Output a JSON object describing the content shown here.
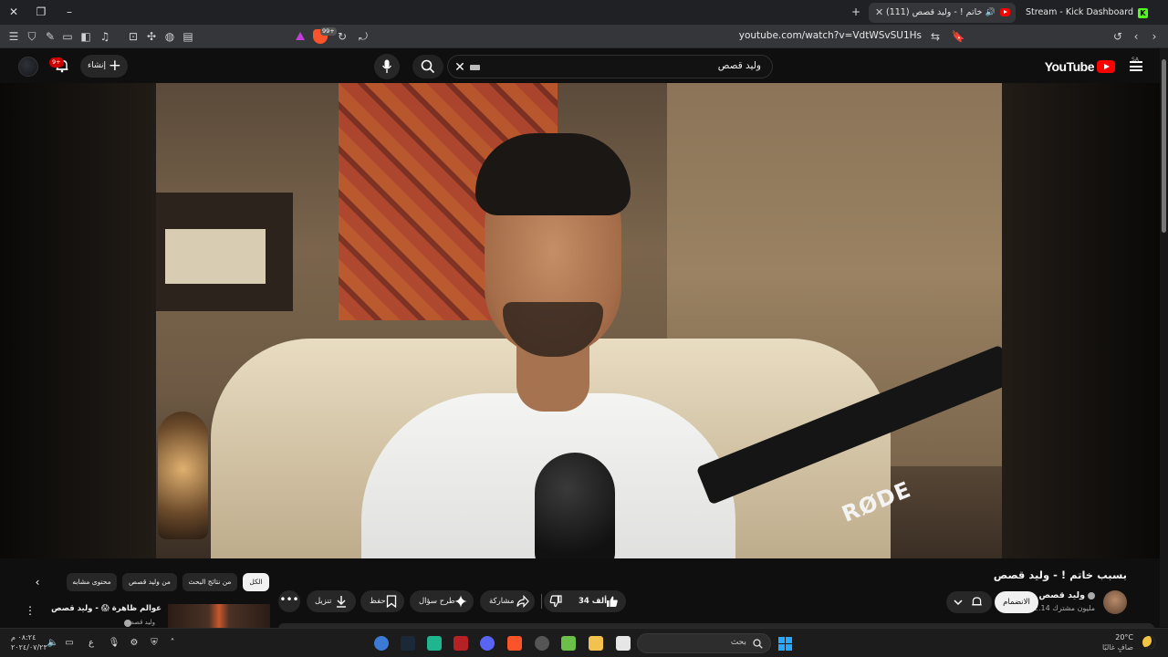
{
  "browser": {
    "tabs": [
      {
        "title": "(111) بسبب خاتم ! - وليد قصص",
        "active": true,
        "favicon": "youtube-icon"
      },
      {
        "title": "Stream - Kick Dashboard",
        "active": false,
        "favicon": "kick-icon"
      }
    ],
    "url": "youtube.com/watch?v=VdtWSvSU1Hs",
    "shields_badge": "99+"
  },
  "youtube": {
    "logo_text": "YouTube",
    "country_code": "SA",
    "search_query": "وليد قصص",
    "create_label": "إنشاء",
    "notifications_badge": "9+"
  },
  "video": {
    "title": "بسبب خاتم ! - وليد قصص",
    "channel": "وليد قصص",
    "subscribers": "2.14 مليون مشترك",
    "join_label": "الانضمام",
    "likes": "34 ألف",
    "share_label": "مشاركة",
    "ask_label": "طرح سؤال",
    "save_label": "حفظ",
    "download_label": "تنزيل",
    "overlay_brand": "RØDE"
  },
  "chips": [
    {
      "label": "الكل",
      "active": true
    },
    {
      "label": "من نتائج البحث",
      "active": false
    },
    {
      "label": "من وليد قصص",
      "active": false
    },
    {
      "label": "محتوى مشابه",
      "active": false
    }
  ],
  "recommended": {
    "title": "عوالم ظاهرة 😱 - وليد قصص",
    "channel": "وليد قصص"
  },
  "taskbar": {
    "search_placeholder": "بحث",
    "weather_temp": "20°C",
    "weather_desc": "صافٍ غالبًا",
    "time": "٠٨:٢٤ م",
    "date": "٢٠٢٤/٠٧/٢٣",
    "lang": "ع",
    "accent": "#29a8ff"
  }
}
